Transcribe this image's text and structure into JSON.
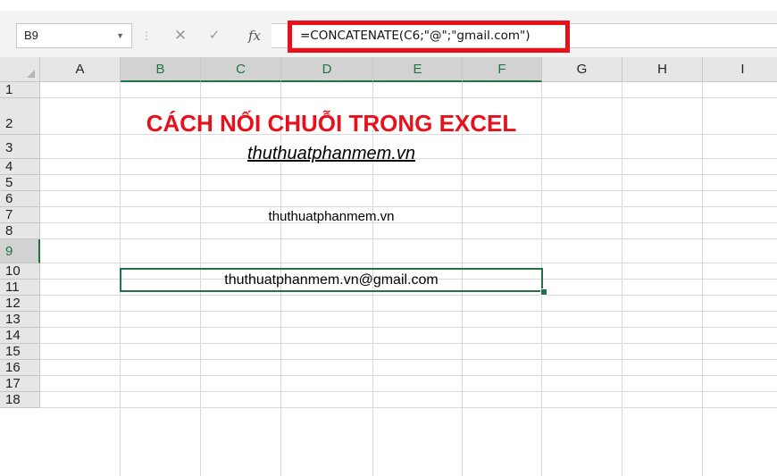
{
  "formula_bar": {
    "name_box": "B9",
    "formula": "=CONCATENATE(C6;\"@\";\"gmail.com\")",
    "cancel_icon": "close-icon",
    "enter_icon": "checkmark-icon",
    "function_icon": "fx-icon",
    "highlight_color": "#e8101a"
  },
  "columns": [
    "A",
    "B",
    "C",
    "D",
    "E",
    "F",
    "G",
    "H",
    "I"
  ],
  "rows": [
    "1",
    "2",
    "3",
    "4",
    "5",
    "6",
    "7",
    "8",
    "9",
    "10",
    "11",
    "12",
    "13",
    "14",
    "15",
    "16",
    "17",
    "18"
  ],
  "selected_column_range": [
    "B",
    "C",
    "D",
    "E",
    "F"
  ],
  "selected_row": "9",
  "cells": {
    "title": "CÁCH NỐI CHUỖI TRONG EXCEL",
    "site": "thuthuatphanmem.vn",
    "c6": "thuthuatphanmem.vn",
    "b9": "thuthuatphanmem.vn@gmail.com"
  },
  "colors": {
    "title": "#e8101a",
    "selection": "#217346"
  }
}
